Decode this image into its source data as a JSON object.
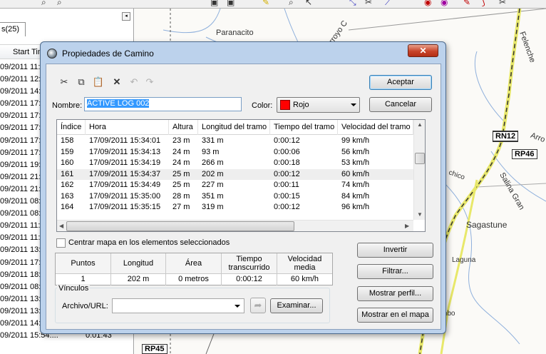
{
  "left_panel": {
    "tab_label": "s(25)",
    "collapse_glyph": "◂",
    "column_header": "Start Tim",
    "rows": [
      {
        "dt": "09/2011 11:",
        "dur": ""
      },
      {
        "dt": "09/2011 12:",
        "dur": ""
      },
      {
        "dt": "09/2011 14:",
        "dur": ""
      },
      {
        "dt": "09/2011 17:",
        "dur": ""
      },
      {
        "dt": "09/2011 17:",
        "dur": ""
      },
      {
        "dt": "09/2011 17:",
        "dur": ""
      },
      {
        "dt": "09/2011 17:",
        "dur": ""
      },
      {
        "dt": "09/2011 17:",
        "dur": ""
      },
      {
        "dt": "09/2011 19:",
        "dur": ""
      },
      {
        "dt": "09/2011 21:",
        "dur": ""
      },
      {
        "dt": "09/2011 21:",
        "dur": ""
      },
      {
        "dt": "09/2011 08:",
        "dur": ""
      },
      {
        "dt": "09/2011 08:",
        "dur": ""
      },
      {
        "dt": "09/2011 11:",
        "dur": ""
      },
      {
        "dt": "09/2011 11:",
        "dur": ""
      },
      {
        "dt": "09/2011 13:",
        "dur": ""
      },
      {
        "dt": "09/2011 17:",
        "dur": ""
      },
      {
        "dt": "09/2011 18:",
        "dur": ""
      },
      {
        "dt": "09/2011 08:",
        "dur": ""
      },
      {
        "dt": "09/2011 13:",
        "dur": ""
      },
      {
        "dt": "09/2011 13:",
        "dur": ""
      },
      {
        "dt": "09/2011 14:",
        "dur": ""
      },
      {
        "dt": "09/2011 15:54:...",
        "dur": "0:01:43"
      }
    ]
  },
  "map": {
    "labels": [
      "Paranacito",
      "Arroyo C",
      "Felenche",
      "Arro",
      "Salina Gran",
      "Sagastune",
      "Laguna",
      "mbo",
      "chico"
    ],
    "shields": [
      "RN12",
      "RP46",
      "RP45"
    ]
  },
  "dialog": {
    "title": "Propiedades de Camino",
    "close_glyph": "✕",
    "toolbar_icons": {
      "cut": "✂",
      "copy": "⧉",
      "paste": "📋",
      "delete": "✕",
      "undo": "↶",
      "redo": "↷"
    },
    "name_label": "Nombre:",
    "name_value": "ACTIVE LOG 002",
    "color_label": "Color:",
    "color_value": "Rojo",
    "color_hex": "#ff0000",
    "buttons": {
      "accept": "Aceptar",
      "cancel": "Cancelar",
      "invert": "Invertir",
      "filter": "Filtrar...",
      "show_profile": "Mostrar perfil...",
      "show_on_map": "Mostrar en el mapa",
      "browse": "Examinar..."
    },
    "grid": {
      "columns": [
        "Índice",
        "Hora",
        "Altura",
        "Longitud del tramo",
        "Tiempo del tramo",
        "Velocidad del tramo"
      ],
      "rows": [
        [
          "158",
          "17/09/2011 15:34:01",
          "23 m",
          "331 m",
          "0:00:12",
          "99 km/h"
        ],
        [
          "159",
          "17/09/2011 15:34:13",
          "24 m",
          "93 m",
          "0:00:06",
          "56 km/h"
        ],
        [
          "160",
          "17/09/2011 15:34:19",
          "24 m",
          "266 m",
          "0:00:18",
          "53 km/h"
        ],
        [
          "161",
          "17/09/2011 15:34:37",
          "25 m",
          "202 m",
          "0:00:12",
          "60 km/h"
        ],
        [
          "162",
          "17/09/2011 15:34:49",
          "25 m",
          "227 m",
          "0:00:11",
          "74 km/h"
        ],
        [
          "163",
          "17/09/2011 15:35:00",
          "28 m",
          "351 m",
          "0:00:15",
          "84 km/h"
        ],
        [
          "164",
          "17/09/2011 15:35:15",
          "27 m",
          "319 m",
          "0:00:12",
          "96 km/h"
        ]
      ]
    },
    "center_map_label": "Centrar mapa en los elementos seleccionados",
    "center_map_checked": false,
    "stats": {
      "headers": [
        "Puntos",
        "Longitud",
        "Área",
        "Tiempo transcurrido",
        "Velocidad media"
      ],
      "values": [
        "1",
        "202 m",
        "0 metros",
        "0:00:12",
        "60 km/h"
      ]
    },
    "links": {
      "group_label": "Vínculos",
      "url_label": "Archivo/URL:",
      "url_value": ""
    }
  }
}
